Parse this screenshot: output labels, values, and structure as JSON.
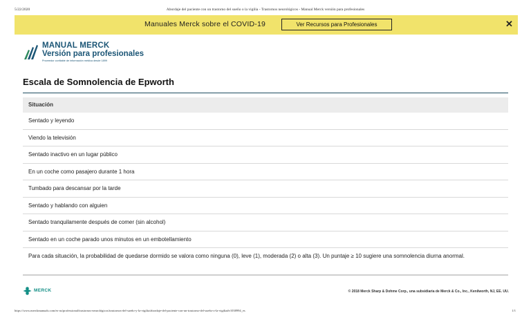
{
  "print_header": {
    "date": "5/22/2020",
    "title": "Abordaje del paciente con un trastorno del sueño o la vigilia - Trastornos neurológicos - Manual Merck versión para profesionales"
  },
  "banner": {
    "message": "Manuales Merck sobre el COVID-19",
    "button_label": "Ver Recursos para Profesionales",
    "close_symbol": "✕",
    "background": "#f1e36b"
  },
  "logo": {
    "line1": "MANUAL MERCK",
    "line2": "Versión para profesionales",
    "tagline": "Proveedor confiable de información médica desde 1899",
    "color": "#1c5676"
  },
  "page_title": "Escala de Somnolencia de Epworth",
  "table": {
    "header": "Situación",
    "rows": [
      "Sentado y leyendo",
      "Viendo la televisión",
      "Sentado inactivo en un lugar público",
      "En un coche como pasajero durante 1 hora",
      "Tumbado para descansar por la tarde",
      "Sentado y hablando con alguien",
      "Sentado tranquilamente después de comer (sin alcohol)",
      "Sentado en un coche parado unos minutos en un embotellamiento"
    ],
    "note": "Para cada situación, la probabilidad de quedarse dormido se valora como ninguna (0), leve (1), moderada (2) o alta (3). Un puntaje ≥ 10 sugiere una somnolencia diurna anormal."
  },
  "footer": {
    "brand": "MERCK",
    "brand_color": "#138f86",
    "copyright": "© 2018 Merck Sharp & Dohme Corp., una subsidiaria de Merck & Co., Inc., Kenilworth, NJ, EE. UU."
  },
  "print_footer": {
    "url": "https://www.merckmanuals.com/es-us/professional/trastornos-neurológicos/trastornos-del-sueño-y-la-vigilia/abordaje-del-paciente-con-un-trastorno-del-sueño-o-la-vigilia#v1038994_es",
    "page": "1/1"
  }
}
